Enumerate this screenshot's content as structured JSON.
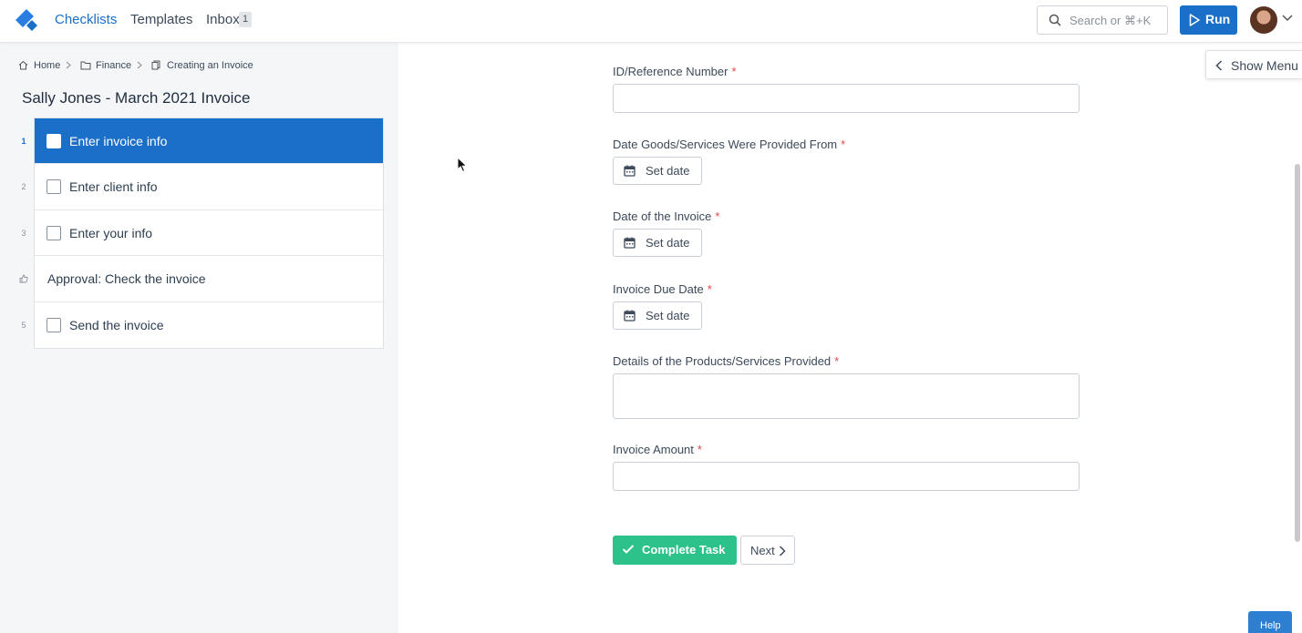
{
  "nav": {
    "checklists": "Checklists",
    "templates": "Templates",
    "inbox": "Inbox",
    "inbox_count": "1",
    "search_placeholder": "Search or ⌘+K",
    "run": "Run"
  },
  "breadcrumb": {
    "home": "Home",
    "folder": "Finance",
    "template": "Creating an Invoice"
  },
  "run_title": "Sally Jones - March 2021 Invoice",
  "tasks": [
    {
      "num": "1",
      "label": "Enter invoice info",
      "active": true
    },
    {
      "num": "2",
      "label": "Enter client info"
    },
    {
      "num": "3",
      "label": "Enter your info"
    },
    {
      "num": "approval-icon",
      "label": "Approval: Check the invoice"
    },
    {
      "num": "5",
      "label": "Send the invoice"
    }
  ],
  "form": {
    "fields": [
      {
        "label": "ID/Reference Number",
        "required": "*",
        "type": "text"
      },
      {
        "label": "Date Goods/Services Were Provided From",
        "required": "*",
        "type": "date"
      },
      {
        "label": "Date of the Invoice",
        "required": "*",
        "type": "date"
      },
      {
        "label": "Invoice Due Date",
        "required": "*",
        "type": "date"
      },
      {
        "label": "Details of the Products/Services Provided",
        "required": "*",
        "type": "textarea"
      },
      {
        "label": "Invoice Amount",
        "required": "*",
        "type": "text"
      }
    ],
    "set_date": "Set date",
    "complete_task": "Complete Task",
    "next": "Next"
  },
  "show_menu": "Show Menu",
  "help": "Help",
  "colors": {
    "primary": "#1a6fc9",
    "success": "#2dc28a",
    "required": "#e0464b",
    "sidebar_bg": "#f5f6f8"
  }
}
